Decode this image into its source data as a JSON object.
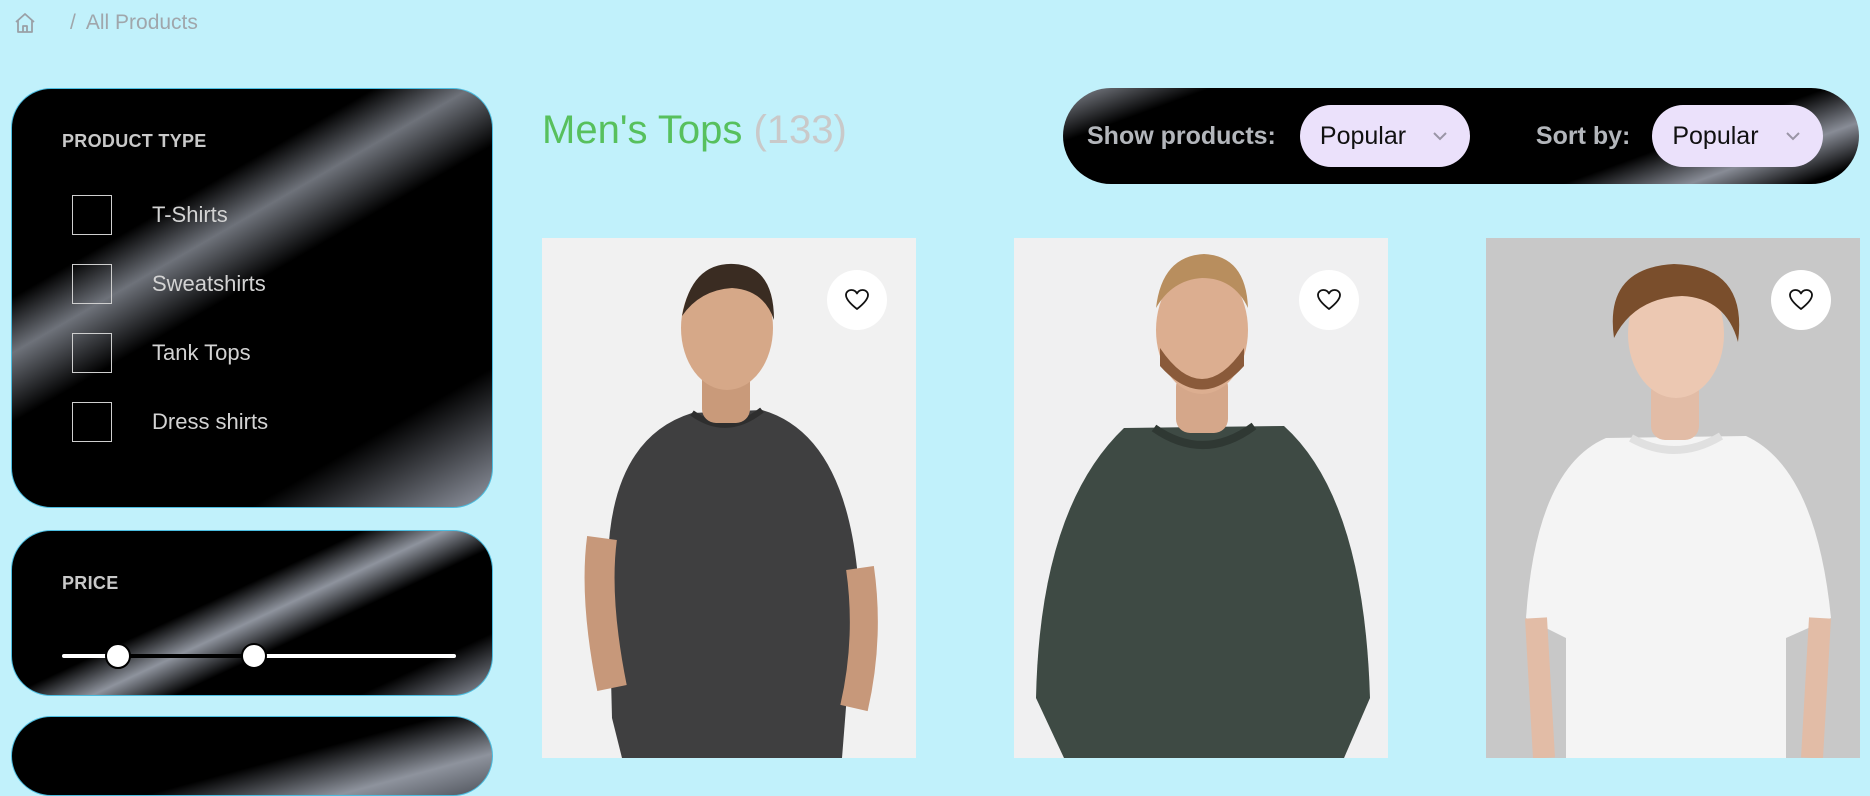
{
  "breadcrumb": {
    "home_icon": "home-icon",
    "separator": "/",
    "current": "All Products"
  },
  "filters": {
    "product_type": {
      "title": "PRODUCT TYPE",
      "options": [
        {
          "label": "T-Shirts",
          "checked": false
        },
        {
          "label": "Sweatshirts",
          "checked": false
        },
        {
          "label": "Tank Tops",
          "checked": false
        },
        {
          "label": "Dress shirts",
          "checked": false
        }
      ]
    },
    "price": {
      "title": "PRICE",
      "min_fraction": 0.15,
      "max_fraction": 0.5
    }
  },
  "listing": {
    "title": "Men's Tops",
    "count": "(133)"
  },
  "toolbar": {
    "show_label": "Show products:",
    "show_value": "Popular",
    "sort_label": "Sort by:",
    "sort_value": "Popular"
  },
  "products": [
    {
      "image": "man in dark grey t-shirt",
      "favorite_icon": "heart-icon"
    },
    {
      "image": "man in dark green sweater",
      "favorite_icon": "heart-icon"
    },
    {
      "image": "young man in white t-shirt",
      "favorite_icon": "heart-icon"
    }
  ],
  "colors": {
    "background": "#c1f1fb",
    "heading": "#57c05d",
    "dropdown": "#ebe1fb",
    "panel_border": "#4cbde0"
  }
}
